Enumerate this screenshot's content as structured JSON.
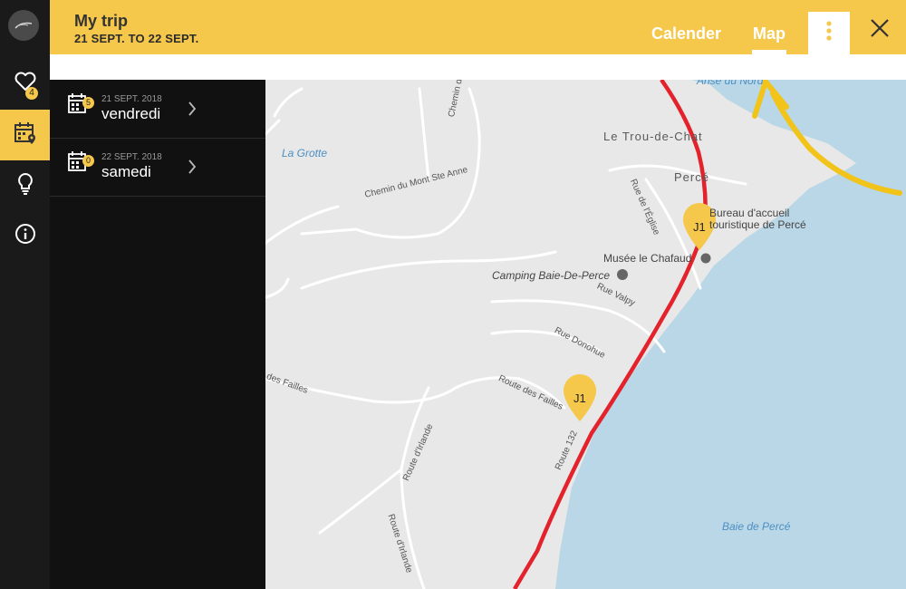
{
  "app": {
    "title": "My trip",
    "dates": "21 SEPT. TO 22 SEPT."
  },
  "tabs": [
    {
      "label": "Calender",
      "active": false
    },
    {
      "label": "Map",
      "active": true
    }
  ],
  "sidebar": {
    "items": [
      {
        "icon": "heart-icon",
        "badge": "4",
        "active": false
      },
      {
        "icon": "calendar-pin-icon",
        "active": true
      },
      {
        "icon": "lightbulb-icon",
        "active": false
      },
      {
        "icon": "info-icon",
        "active": false
      }
    ]
  },
  "days": [
    {
      "date": "21 SEPT. 2018",
      "name": "vendredi",
      "count": "5"
    },
    {
      "date": "22 SEPT. 2018",
      "name": "samedi",
      "count": "0"
    }
  ],
  "map": {
    "labels": {
      "anse": "Anse du Nord",
      "trou": "Le Trou-de-Chat",
      "grotte": "La Grotte",
      "perce": "Percé",
      "accueil1": "Bureau d'accueil",
      "accueil2": "touristique de Percé",
      "musee": "Musée le Chafaud",
      "camping": "Camping Baie-De-Perce",
      "montste": "Chemin du Mont Ste Anne",
      "montste2": "Chemin du Mont Ste",
      "eglise": "Rue de l'Église",
      "valpy": "Rue Valpy",
      "donohue": "Rue Donohue",
      "failles": "Route des Failles",
      "failles2": "des Failles",
      "irlande": "Route d'Irlande",
      "irlande2": "Route d'Irlande",
      "route132": "Route 132",
      "baie": "Baie de Percé"
    },
    "pins": [
      {
        "label": "J1"
      },
      {
        "label": "J1"
      }
    ]
  },
  "colors": {
    "accent": "#f5c84c",
    "route": "#e3222b",
    "water": "#b9d7e6",
    "land": "#e8e8e8"
  }
}
